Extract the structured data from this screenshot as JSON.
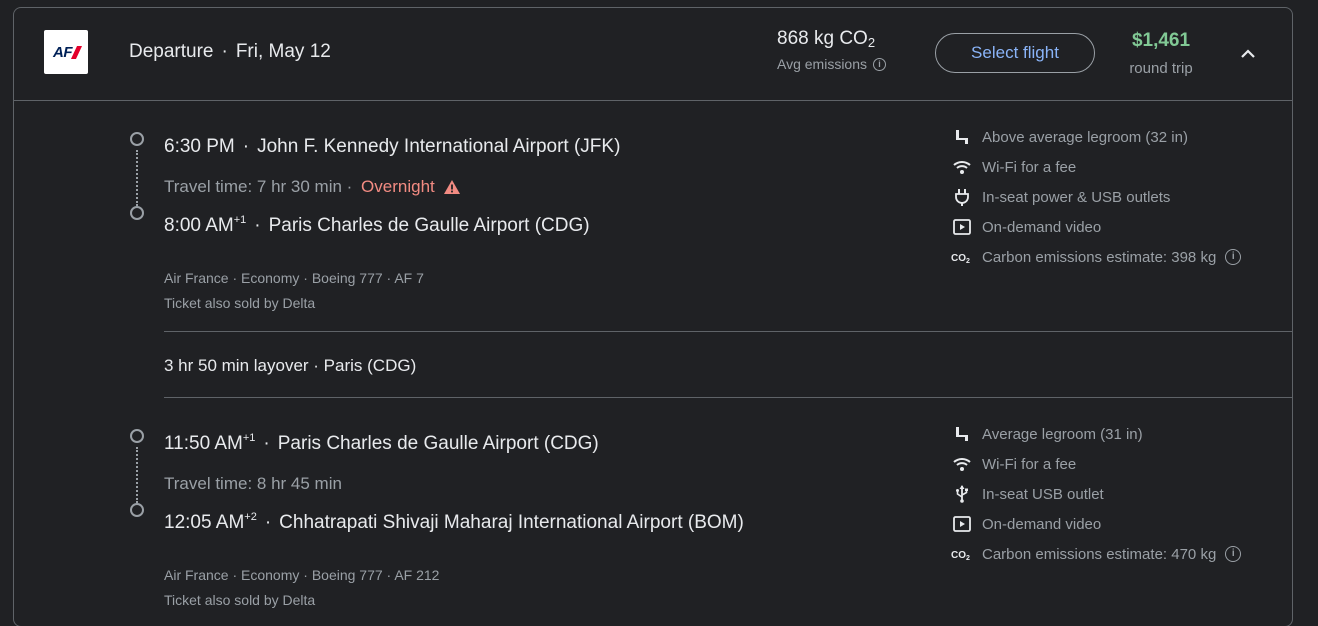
{
  "header": {
    "airline_logo_text": "AF",
    "title": "Departure",
    "date": "Fri, May 12",
    "emissions_value": "868 kg CO",
    "emissions_sub": "2",
    "emissions_label": "Avg emissions",
    "select_label": "Select flight",
    "price": "$1,461",
    "price_sub": "round trip"
  },
  "segments": [
    {
      "depart_time": "6:30 PM",
      "depart_sup": "",
      "depart_airport": "John F. Kennedy International Airport (JFK)",
      "travel_time": "Travel time: 7 hr 30 min",
      "travel_sep": " · ",
      "overnight": "Overnight",
      "arrive_time": "8:00 AM",
      "arrive_sup": "+1",
      "arrive_airport": "Paris Charles de Gaulle Airport (CDG)",
      "details": "Air France · Economy · Boeing 777 · AF 7",
      "sold_by": "Ticket also sold by Delta",
      "amenities": [
        {
          "icon": "legroom-icon",
          "text": "Above average legroom (32 in)"
        },
        {
          "icon": "wifi-icon",
          "text": "Wi-Fi for a fee"
        },
        {
          "icon": "power-plug-icon",
          "text": "In-seat power & USB outlets"
        },
        {
          "icon": "video-icon",
          "text": "On-demand video"
        },
        {
          "icon": "co2-icon",
          "text": "Carbon emissions estimate: 398 kg"
        }
      ]
    },
    {
      "depart_time": "11:50 AM",
      "depart_sup": "+1",
      "depart_airport": "Paris Charles de Gaulle Airport (CDG)",
      "travel_time": "Travel time: 8 hr 45 min",
      "arrive_time": "12:05 AM",
      "arrive_sup": "+2",
      "arrive_airport": "Chhatrapati Shivaji Maharaj International Airport (BOM)",
      "details": "Air France · Economy · Boeing 777 · AF 212",
      "sold_by": "Ticket also sold by Delta",
      "amenities": [
        {
          "icon": "legroom-icon",
          "text": "Average legroom (31 in)"
        },
        {
          "icon": "wifi-icon",
          "text": "Wi-Fi for a fee"
        },
        {
          "icon": "usb-icon",
          "text": "In-seat USB outlet"
        },
        {
          "icon": "video-icon",
          "text": "On-demand video"
        },
        {
          "icon": "co2-icon",
          "text": "Carbon emissions estimate: 470 kg"
        }
      ]
    }
  ],
  "layover": "3 hr 50 min layover · Paris (CDG)",
  "colors": {
    "background": "#202124",
    "accent_blue": "#8ab4f8",
    "price_green": "#81c995",
    "overnight_red": "#f28b82",
    "muted": "#9aa0a6"
  }
}
